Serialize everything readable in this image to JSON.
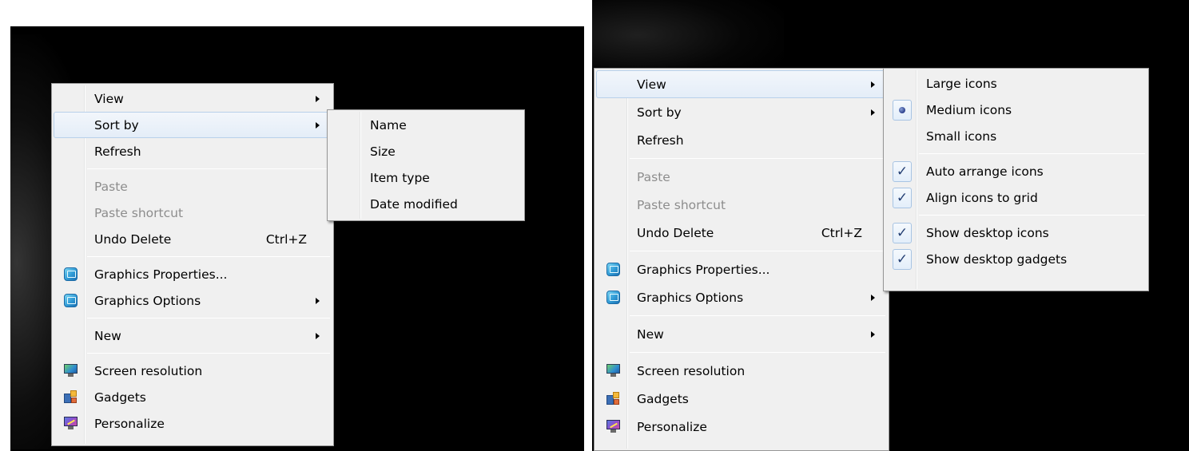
{
  "left_menu": {
    "items": [
      {
        "label": "View"
      },
      {
        "label": "Sort by"
      },
      {
        "label": "Refresh"
      },
      {
        "label": "Paste"
      },
      {
        "label": "Paste shortcut"
      },
      {
        "label": "Undo Delete",
        "shortcut": "Ctrl+Z"
      },
      {
        "label": "Graphics Properties...",
        "icon": "graphics-icon"
      },
      {
        "label": "Graphics Options",
        "icon": "graphics-icon"
      },
      {
        "label": "New"
      },
      {
        "label": "Screen resolution",
        "icon": "monitor-icon"
      },
      {
        "label": "Gadgets",
        "icon": "gadgets-icon"
      },
      {
        "label": "Personalize",
        "icon": "personalize-icon"
      }
    ]
  },
  "sort_submenu": {
    "items": [
      {
        "label": "Name"
      },
      {
        "label": "Size"
      },
      {
        "label": "Item type"
      },
      {
        "label": "Date modified"
      }
    ]
  },
  "right_menu": {
    "items": [
      {
        "label": "View"
      },
      {
        "label": "Sort by"
      },
      {
        "label": "Refresh"
      },
      {
        "label": "Paste"
      },
      {
        "label": "Paste shortcut"
      },
      {
        "label": "Undo Delete",
        "shortcut": "Ctrl+Z"
      },
      {
        "label": "Graphics Properties...",
        "icon": "graphics-icon"
      },
      {
        "label": "Graphics Options",
        "icon": "graphics-icon"
      },
      {
        "label": "New"
      },
      {
        "label": "Screen resolution",
        "icon": "monitor-icon"
      },
      {
        "label": "Gadgets",
        "icon": "gadgets-icon"
      },
      {
        "label": "Personalize",
        "icon": "personalize-icon"
      }
    ]
  },
  "view_submenu": {
    "items": [
      {
        "label": "Large icons",
        "selected": false
      },
      {
        "label": "Medium icons",
        "selected": true
      },
      {
        "label": "Small icons",
        "selected": false
      },
      {
        "label": "Auto arrange icons",
        "checked": true
      },
      {
        "label": "Align icons to grid",
        "checked": true
      },
      {
        "label": "Show desktop icons",
        "checked": true
      },
      {
        "label": "Show desktop gadgets",
        "checked": true
      }
    ],
    "check_glyph": "✓"
  },
  "colors": {
    "highlight_border": "#b8d0ea",
    "disabled_text": "#8d8d8d",
    "menu_background": "#f0f0f0",
    "desktop_background": "#000000"
  }
}
